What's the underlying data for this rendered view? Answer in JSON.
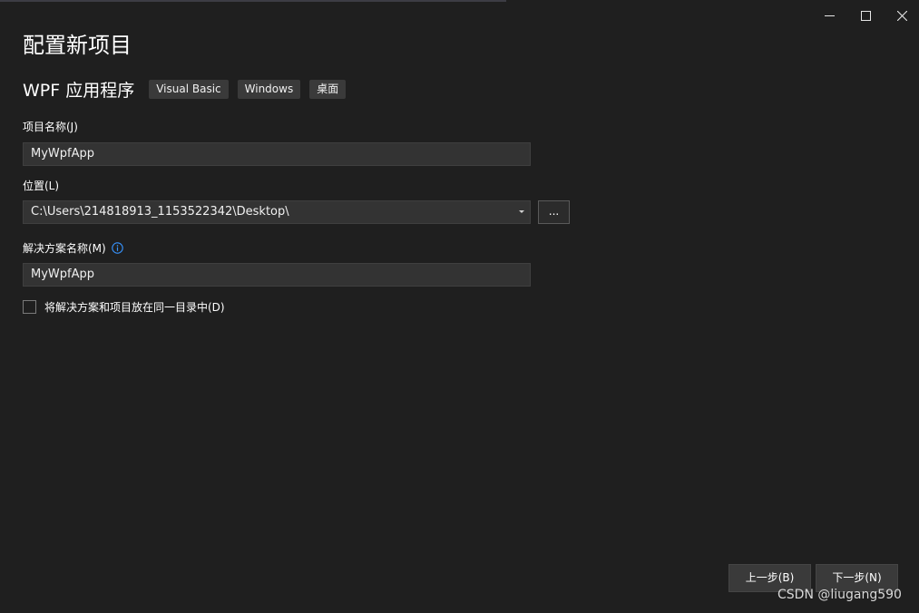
{
  "window_controls": {
    "minimize_icon": "minimize-icon",
    "maximize_icon": "maximize-icon",
    "close_icon": "close-icon"
  },
  "page": {
    "title": "配置新项目"
  },
  "template": {
    "name": "WPF 应用程序",
    "tags": [
      "Visual Basic",
      "Windows",
      "桌面"
    ]
  },
  "project_name": {
    "label": "项目名称(J)",
    "value": "MyWpfApp"
  },
  "location": {
    "label": "位置(L)",
    "value": "C:\\Users\\214818913_1153522342\\Desktop\\",
    "browse_label": "..."
  },
  "solution_name": {
    "label": "解决方案名称(M)",
    "info_icon": "info-icon",
    "value": "MyWpfApp"
  },
  "same_directory": {
    "label": "将解决方案和项目放在同一目录中(D)",
    "checked": false
  },
  "footer": {
    "back_label": "上一步(B)",
    "next_label": "下一步(N)"
  },
  "watermark": "CSDN @liugang590",
  "colors": {
    "background": "#1f1f1f",
    "field_background": "#333333",
    "button_background": "#3a3a3a",
    "info_accent": "#3794ff"
  }
}
